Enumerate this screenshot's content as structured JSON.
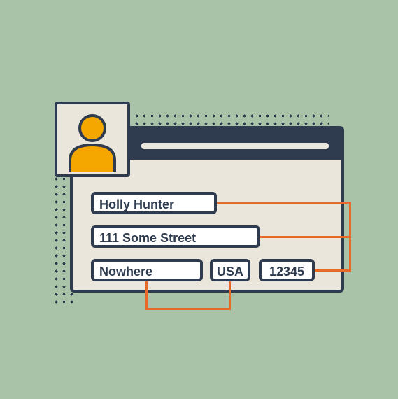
{
  "colors": {
    "bg": "#a9c3a8",
    "card": "#eae6dc",
    "outline": "#2f3b4e",
    "accent": "#e86a2a",
    "avatar": "#f5a700"
  },
  "form": {
    "name": "Holly Hunter",
    "street": "111 Some Street",
    "city": "Nowhere",
    "country": "USA",
    "zip": "12345"
  }
}
